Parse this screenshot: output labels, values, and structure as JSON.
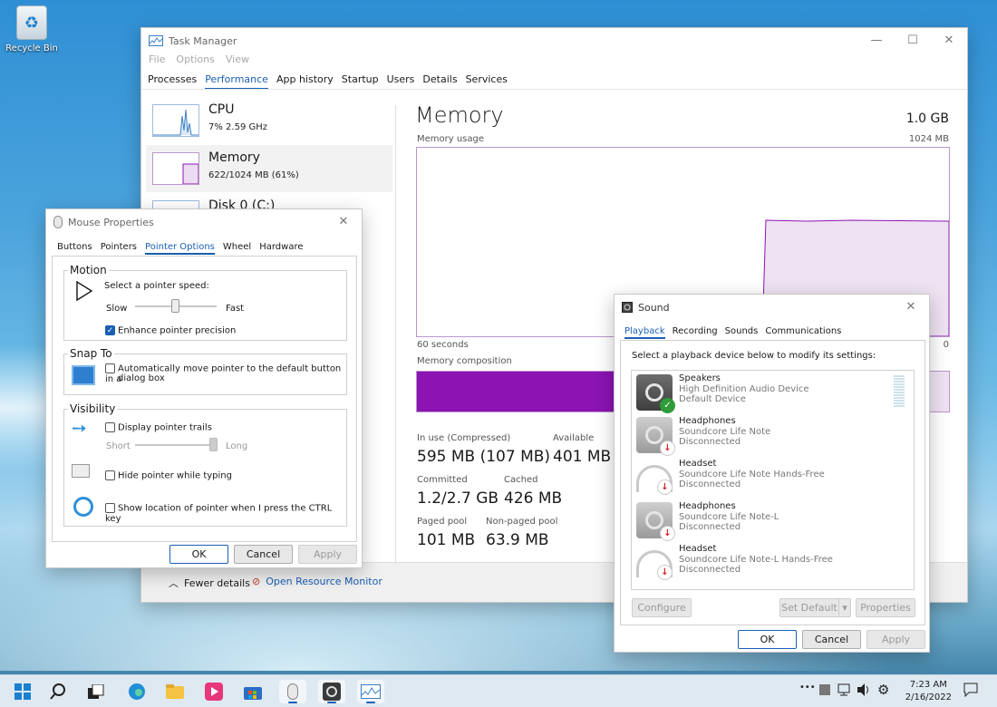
{
  "desktop": {
    "recycle_bin_label": "Recycle Bin"
  },
  "task_manager": {
    "title": "Task Manager",
    "menu": [
      "File",
      "Options",
      "View"
    ],
    "tabs": [
      "Processes",
      "Performance",
      "App history",
      "Startup",
      "Users",
      "Details",
      "Services"
    ],
    "active_tab": "Performance",
    "sidebar": [
      {
        "name": "CPU",
        "sub": "7%  2.59 GHz"
      },
      {
        "name": "Memory",
        "sub": "622/1024 MB (61%)"
      },
      {
        "name": "Disk 0 (C:)",
        "sub": ""
      }
    ],
    "heading": "Memory",
    "total": "1.0 GB",
    "usage_label": "Memory usage",
    "usage_max": "1024 MB",
    "time_label": "60 seconds",
    "zero_label": "0",
    "composition_label": "Memory composition",
    "composition_used_fraction": 0.61,
    "stats": {
      "in_use_label": "In use (Compressed)",
      "in_use": "595 MB (107 MB)",
      "available_label": "Available",
      "available": "401 MB",
      "committed_label": "Committed",
      "committed": "1.2/2.7 GB",
      "cached_label": "Cached",
      "cached": "426 MB",
      "paged_label": "Paged pool",
      "paged": "101 MB",
      "nonpaged_label": "Non-paged pool",
      "nonpaged": "63.9 MB"
    },
    "fewer_details": "Fewer details",
    "open_resource_monitor": "Open Resource Monitor",
    "graph_usage_fraction": 0.61,
    "accent": "#8b14b3"
  },
  "mouse_properties": {
    "title": "Mouse Properties",
    "tabs": [
      "Buttons",
      "Pointers",
      "Pointer Options",
      "Wheel",
      "Hardware"
    ],
    "active_tab": "Pointer Options",
    "motion": {
      "title": "Motion",
      "speed_label": "Select a pointer speed:",
      "slow": "Slow",
      "fast": "Fast",
      "enhance": "Enhance pointer precision",
      "enhance_checked": true
    },
    "snap": {
      "title": "Snap To",
      "text1": "Automatically move pointer to the default button in a",
      "text2": "dialog box"
    },
    "visibility": {
      "title": "Visibility",
      "trails": "Display pointer trails",
      "short": "Short",
      "long": "Long",
      "hide": "Hide pointer while typing",
      "ctrl": "Show location of pointer when I press the CTRL key"
    },
    "ok": "OK",
    "cancel": "Cancel",
    "apply": "Apply"
  },
  "sound": {
    "title": "Sound",
    "tabs": [
      "Playback",
      "Recording",
      "Sounds",
      "Communications"
    ],
    "active_tab": "Playback",
    "instruction": "Select a playback device below to modify its settings:",
    "devices": [
      {
        "name": "Speakers",
        "desc": "High Definition Audio Device",
        "status": "Default Device",
        "icon": "speaker-icon"
      },
      {
        "name": "Headphones",
        "desc": "Soundcore Life Note",
        "status": "Disconnected",
        "icon": "headphones-icon"
      },
      {
        "name": "Headset",
        "desc": "Soundcore Life Note Hands-Free",
        "status": "Disconnected",
        "icon": "headset-icon"
      },
      {
        "name": "Headphones",
        "desc": "Soundcore Life Note-L",
        "status": "Disconnected",
        "icon": "headphones-icon"
      },
      {
        "name": "Headset",
        "desc": "Soundcore Life Note-L Hands-Free",
        "status": "Disconnected",
        "icon": "headset-icon"
      }
    ],
    "configure": "Configure",
    "set_default": "Set Default",
    "properties": "Properties",
    "ok": "OK",
    "cancel": "Cancel",
    "apply": "Apply"
  },
  "taskbar": {
    "time": "7:23 AM",
    "date": "2/16/2022",
    "overflow": "•••"
  }
}
